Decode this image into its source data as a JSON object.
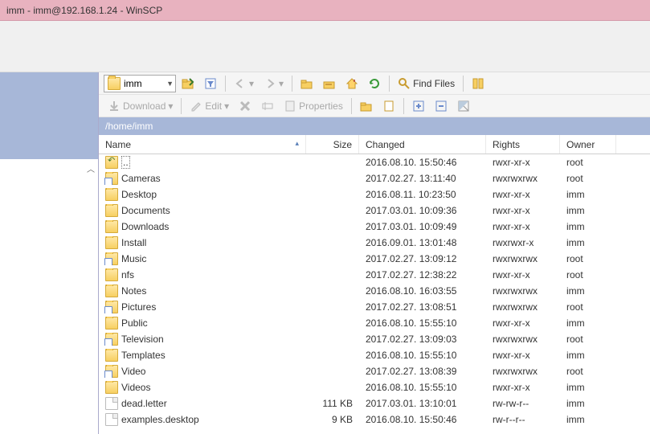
{
  "window": {
    "title": "imm - imm@192.168.1.24 - WinSCP"
  },
  "toolbar1": {
    "combo_label": "imm",
    "find_files": "Find Files"
  },
  "toolbar2": {
    "download": "Download",
    "edit": "Edit",
    "properties": "Properties"
  },
  "path": "/home/imm",
  "headers": {
    "name": "Name",
    "size": "Size",
    "changed": "Changed",
    "rights": "Rights",
    "owner": "Owner"
  },
  "rows": [
    {
      "icon": "up",
      "name": "..",
      "size": "",
      "changed": "2016.08.10. 15:50:46",
      "rights": "rwxr-xr-x",
      "owner": "root",
      "selected": true
    },
    {
      "icon": "folder-link",
      "name": "Cameras",
      "size": "",
      "changed": "2017.02.27. 13:11:40",
      "rights": "rwxrwxrwx",
      "owner": "root"
    },
    {
      "icon": "folder",
      "name": "Desktop",
      "size": "",
      "changed": "2016.08.11. 10:23:50",
      "rights": "rwxr-xr-x",
      "owner": "imm"
    },
    {
      "icon": "folder",
      "name": "Documents",
      "size": "",
      "changed": "2017.03.01. 10:09:36",
      "rights": "rwxr-xr-x",
      "owner": "imm"
    },
    {
      "icon": "folder",
      "name": "Downloads",
      "size": "",
      "changed": "2017.03.01. 10:09:49",
      "rights": "rwxr-xr-x",
      "owner": "imm"
    },
    {
      "icon": "folder",
      "name": "Install",
      "size": "",
      "changed": "2016.09.01. 13:01:48",
      "rights": "rwxrwxr-x",
      "owner": "imm"
    },
    {
      "icon": "folder-link",
      "name": "Music",
      "size": "",
      "changed": "2017.02.27. 13:09:12",
      "rights": "rwxrwxrwx",
      "owner": "root"
    },
    {
      "icon": "folder",
      "name": "nfs",
      "size": "",
      "changed": "2017.02.27. 12:38:22",
      "rights": "rwxr-xr-x",
      "owner": "root"
    },
    {
      "icon": "folder",
      "name": "Notes",
      "size": "",
      "changed": "2016.08.10. 16:03:55",
      "rights": "rwxrwxrwx",
      "owner": "imm"
    },
    {
      "icon": "folder-link",
      "name": "Pictures",
      "size": "",
      "changed": "2017.02.27. 13:08:51",
      "rights": "rwxrwxrwx",
      "owner": "root"
    },
    {
      "icon": "folder",
      "name": "Public",
      "size": "",
      "changed": "2016.08.10. 15:55:10",
      "rights": "rwxr-xr-x",
      "owner": "imm"
    },
    {
      "icon": "folder-link",
      "name": "Television",
      "size": "",
      "changed": "2017.02.27. 13:09:03",
      "rights": "rwxrwxrwx",
      "owner": "root"
    },
    {
      "icon": "folder",
      "name": "Templates",
      "size": "",
      "changed": "2016.08.10. 15:55:10",
      "rights": "rwxr-xr-x",
      "owner": "imm"
    },
    {
      "icon": "folder-link",
      "name": "Video",
      "size": "",
      "changed": "2017.02.27. 13:08:39",
      "rights": "rwxrwxrwx",
      "owner": "root"
    },
    {
      "icon": "folder",
      "name": "Videos",
      "size": "",
      "changed": "2016.08.10. 15:55:10",
      "rights": "rwxr-xr-x",
      "owner": "imm"
    },
    {
      "icon": "file",
      "name": "dead.letter",
      "size": "111 KB",
      "changed": "2017.03.01. 13:10:01",
      "rights": "rw-rw-r--",
      "owner": "imm"
    },
    {
      "icon": "file",
      "name": "examples.desktop",
      "size": "9 KB",
      "changed": "2016.08.10. 15:50:46",
      "rights": "rw-r--r--",
      "owner": "imm"
    }
  ]
}
